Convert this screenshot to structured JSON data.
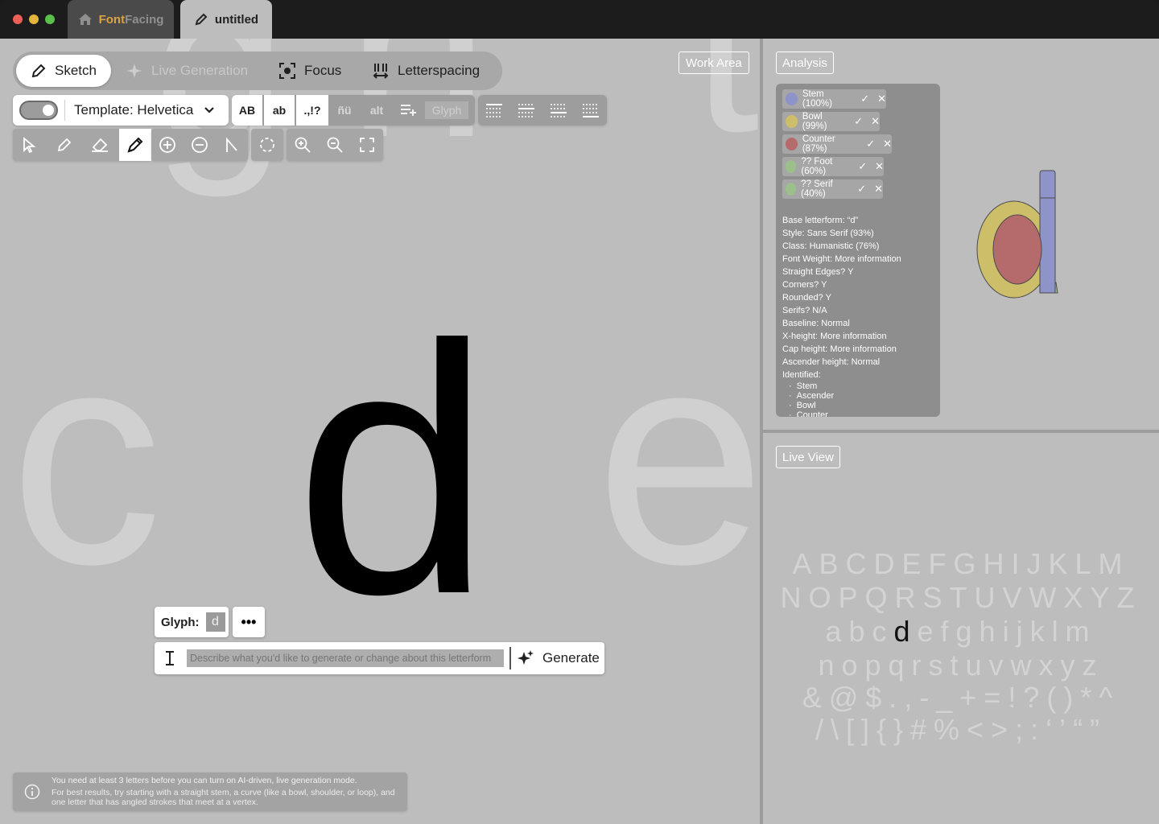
{
  "window": {
    "tabs": [
      {
        "label_brand": "Font",
        "label_rest": "Facing",
        "icon": "home-icon"
      },
      {
        "label": "untitled",
        "icon": "pencil-icon"
      }
    ]
  },
  "modes": [
    {
      "label": "Sketch",
      "icon": "pencil-icon",
      "state": "active"
    },
    {
      "label": "Live Generation",
      "icon": "sparkle-icon",
      "state": "disabled"
    },
    {
      "label": "Focus",
      "icon": "focus-icon",
      "state": "normal"
    },
    {
      "label": "Letterspacing",
      "icon": "letterspacing-icon",
      "state": "normal"
    }
  ],
  "toolbar": {
    "template_label": "Template: Helvetica",
    "case_buttons": [
      "AB",
      "ab",
      ".,!?",
      "ñü",
      "alt"
    ],
    "glyph_placeholder": "Glyph"
  },
  "work_area": {
    "label": "Work Area",
    "main_glyph": "d",
    "neighbor_left": "c",
    "neighbor_right": "e",
    "bg_top_left": "g",
    "bg_top_mid": "n",
    "bg_top_right": "t"
  },
  "glyph_box": {
    "label": "Glyph:",
    "value": "d",
    "more": "•••"
  },
  "prompt": {
    "placeholder": "Describe what you'd like to generate or change about this letterform",
    "button_label": "Generate"
  },
  "info": {
    "line1": "You need at least 3 letters before you can turn on AI-driven, live generation mode.",
    "line2": "For best results, try starting with a straight stem, a curve (like a bowl, shoulder, or loop), and one letter that has angled strokes that meet at a vertex."
  },
  "analysis": {
    "label": "Analysis",
    "features": [
      {
        "label": "Stem (100%)",
        "color": "#8e93c9"
      },
      {
        "label": "Bowl (99%)",
        "color": "#cdbf6a"
      },
      {
        "label": "Counter (87%)",
        "color": "#b56b6b"
      },
      {
        "label": "?? Foot (60%)",
        "color": "#9bc08a"
      },
      {
        "label": "?? Serif (40%)",
        "color": "#9bc08a"
      }
    ],
    "details": [
      "Base letterform: “d”",
      "Style: Sans Serif (93%)",
      "Class: Humanistic (76%)",
      "Font Weight: More information",
      "Straight Edges? Y",
      "Corners? Y",
      "Rounded? Y",
      "Serifs? N/A",
      "Baseline: Normal",
      "X-height: More information",
      "Cap height: More information",
      "Ascender height: Normal",
      "Identified:"
    ],
    "identified": [
      "Stem",
      "Ascender",
      "Bowl",
      "Counter"
    ]
  },
  "live_view": {
    "label": "Live View",
    "rows": [
      "ABCDEFGHIJKLM",
      "NOPQRSTUVWXYZ",
      "abcdefghijklm",
      "nopqrstuvwxyz",
      "&@$.,-_+=!?()*^",
      "/\\[]{}#%<>;:‘’“”"
    ],
    "current": "d"
  },
  "colors": {
    "canvas": "#bdbdbd",
    "glyph": "#000000",
    "brand_accent": "#d9a441"
  }
}
